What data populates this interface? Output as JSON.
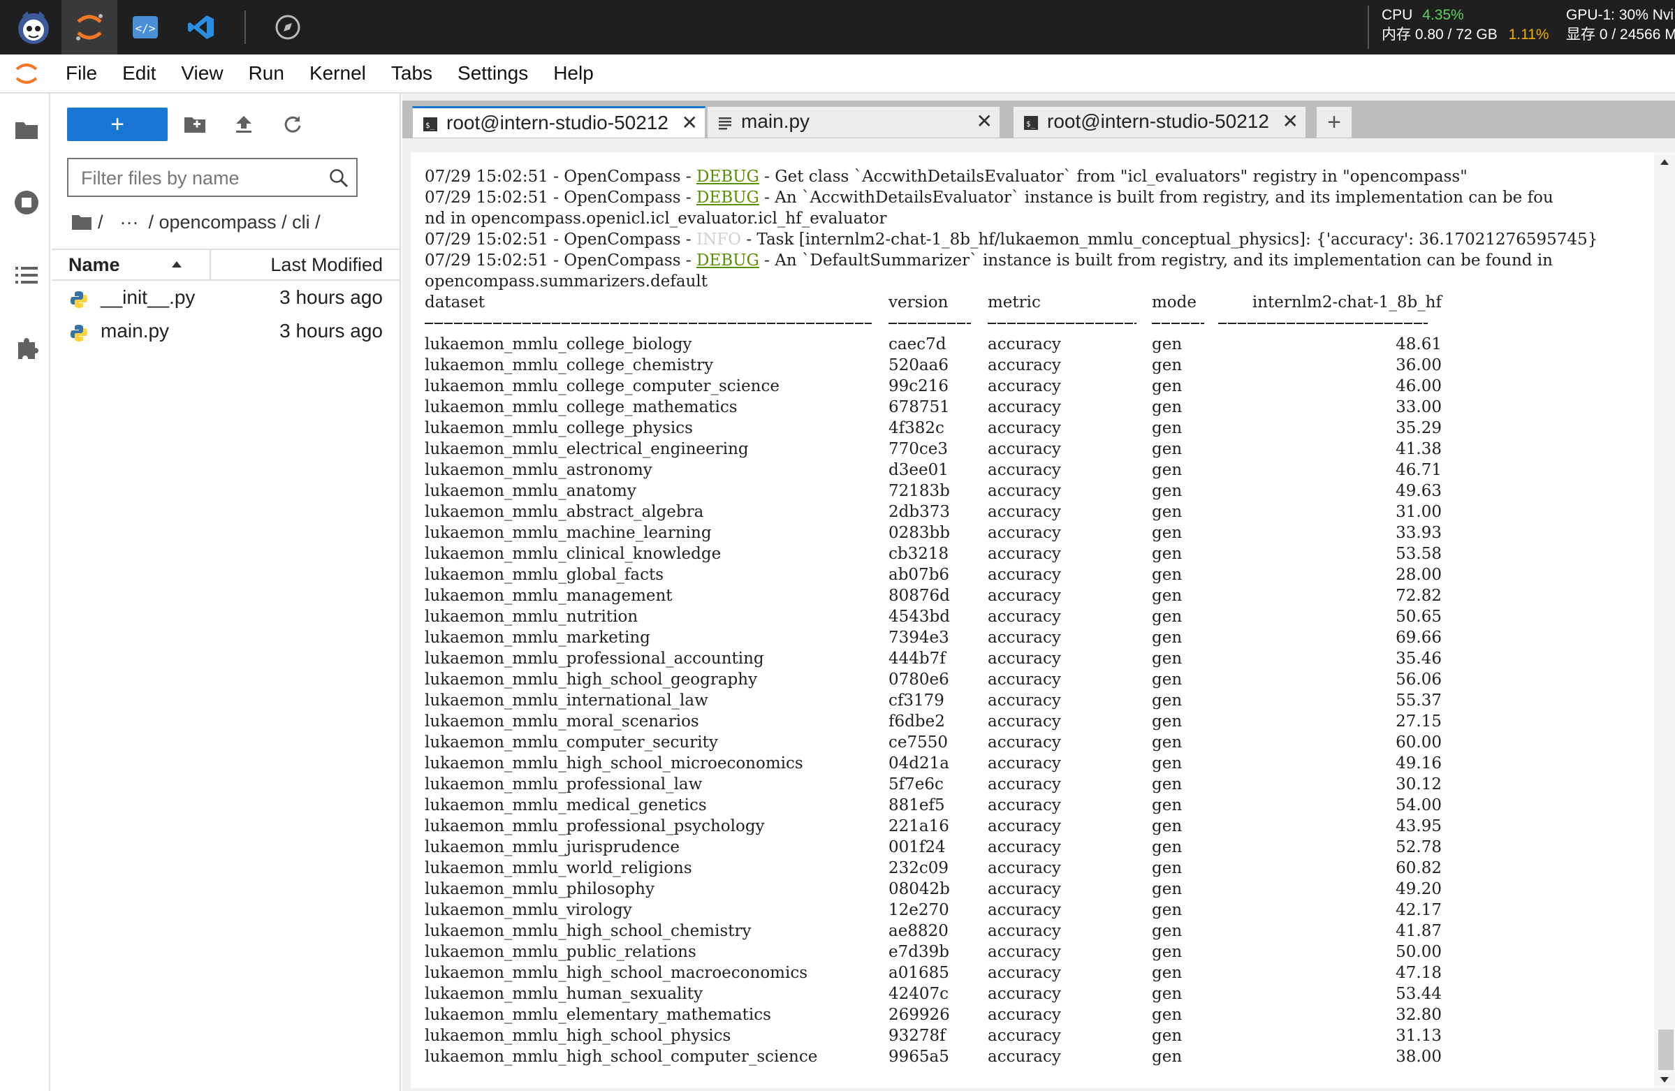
{
  "sysmon": {
    "cpu_label": "CPU",
    "cpu_value": "4.35%",
    "gpu_label": "GPU-1: 30% Nvi",
    "mem_label": "内存 0.80 / 72 GB",
    "mem_pct": "1.11%",
    "vram_label": "显存 0 / 24566 M"
  },
  "menu": [
    "File",
    "Edit",
    "View",
    "Run",
    "Kernel",
    "Tabs",
    "Settings",
    "Help"
  ],
  "filebrowser": {
    "new_label": "+",
    "filter_placeholder": "Filter files by name",
    "crumbs": [
      "/",
      "···",
      "/ opencompass / cli /"
    ],
    "col_name": "Name",
    "col_modified": "Last Modified",
    "files": [
      {
        "name": "__init__.py",
        "modified": "3 hours ago"
      },
      {
        "name": "main.py",
        "modified": "3 hours ago"
      }
    ]
  },
  "tabs": [
    {
      "title": "root@intern-studio-50212",
      "icon": "terminal-icon"
    },
    {
      "title": "main.py",
      "icon": "text-file-icon"
    },
    {
      "title": "root@intern-studio-50212",
      "icon": "terminal-icon"
    }
  ],
  "terminal": {
    "log": [
      {
        "pre": "07/29 15:02:51 - OpenCompass - ",
        "level": "DEBUG",
        "post": " - Get class `AccwithDetailsEvaluator` from \"icl_evaluators\" registry in \"opencompass\""
      },
      {
        "pre": "07/29 15:02:51 - OpenCompass - ",
        "level": "DEBUG",
        "post": " - An `AccwithDetailsEvaluator` instance is built from registry, and its implementation can be fou"
      },
      {
        "pre": "nd in opencompass.openicl.icl_evaluator.icl_hf_evaluator",
        "level": "",
        "post": ""
      },
      {
        "pre": "07/29 15:02:51 - OpenCompass - ",
        "level": "INFO",
        "post": " - Task [internlm2-chat-1_8b_hf/lukaemon_mmlu_conceptual_physics]: {'accuracy': 36.17021276595745}"
      },
      {
        "pre": "07/29 15:02:51 - OpenCompass - ",
        "level": "DEBUG",
        "post": " - An `DefaultSummarizer` instance is built from registry, and its implementation can be found in"
      },
      {
        "pre": "opencompass.summarizers.default",
        "level": "",
        "post": ""
      }
    ],
    "headers": {
      "dataset": "dataset",
      "version": "version",
      "metric": "metric",
      "mode": "mode",
      "model": "internlm2-chat-1_8b_hf"
    },
    "rows": [
      [
        "lukaemon_mmlu_college_biology",
        "caec7d",
        "accuracy",
        "gen",
        "48.61"
      ],
      [
        "lukaemon_mmlu_college_chemistry",
        "520aa6",
        "accuracy",
        "gen",
        "36.00"
      ],
      [
        "lukaemon_mmlu_college_computer_science",
        "99c216",
        "accuracy",
        "gen",
        "46.00"
      ],
      [
        "lukaemon_mmlu_college_mathematics",
        "678751",
        "accuracy",
        "gen",
        "33.00"
      ],
      [
        "lukaemon_mmlu_college_physics",
        "4f382c",
        "accuracy",
        "gen",
        "35.29"
      ],
      [
        "lukaemon_mmlu_electrical_engineering",
        "770ce3",
        "accuracy",
        "gen",
        "41.38"
      ],
      [
        "lukaemon_mmlu_astronomy",
        "d3ee01",
        "accuracy",
        "gen",
        "46.71"
      ],
      [
        "lukaemon_mmlu_anatomy",
        "72183b",
        "accuracy",
        "gen",
        "49.63"
      ],
      [
        "lukaemon_mmlu_abstract_algebra",
        "2db373",
        "accuracy",
        "gen",
        "31.00"
      ],
      [
        "lukaemon_mmlu_machine_learning",
        "0283bb",
        "accuracy",
        "gen",
        "33.93"
      ],
      [
        "lukaemon_mmlu_clinical_knowledge",
        "cb3218",
        "accuracy",
        "gen",
        "53.58"
      ],
      [
        "lukaemon_mmlu_global_facts",
        "ab07b6",
        "accuracy",
        "gen",
        "28.00"
      ],
      [
        "lukaemon_mmlu_management",
        "80876d",
        "accuracy",
        "gen",
        "72.82"
      ],
      [
        "lukaemon_mmlu_nutrition",
        "4543bd",
        "accuracy",
        "gen",
        "50.65"
      ],
      [
        "lukaemon_mmlu_marketing",
        "7394e3",
        "accuracy",
        "gen",
        "69.66"
      ],
      [
        "lukaemon_mmlu_professional_accounting",
        "444b7f",
        "accuracy",
        "gen",
        "35.46"
      ],
      [
        "lukaemon_mmlu_high_school_geography",
        "0780e6",
        "accuracy",
        "gen",
        "56.06"
      ],
      [
        "lukaemon_mmlu_international_law",
        "cf3179",
        "accuracy",
        "gen",
        "55.37"
      ],
      [
        "lukaemon_mmlu_moral_scenarios",
        "f6dbe2",
        "accuracy",
        "gen",
        "27.15"
      ],
      [
        "lukaemon_mmlu_computer_security",
        "ce7550",
        "accuracy",
        "gen",
        "60.00"
      ],
      [
        "lukaemon_mmlu_high_school_microeconomics",
        "04d21a",
        "accuracy",
        "gen",
        "49.16"
      ],
      [
        "lukaemon_mmlu_professional_law",
        "5f7e6c",
        "accuracy",
        "gen",
        "30.12"
      ],
      [
        "lukaemon_mmlu_medical_genetics",
        "881ef5",
        "accuracy",
        "gen",
        "54.00"
      ],
      [
        "lukaemon_mmlu_professional_psychology",
        "221a16",
        "accuracy",
        "gen",
        "43.95"
      ],
      [
        "lukaemon_mmlu_jurisprudence",
        "001f24",
        "accuracy",
        "gen",
        "52.78"
      ],
      [
        "lukaemon_mmlu_world_religions",
        "232c09",
        "accuracy",
        "gen",
        "60.82"
      ],
      [
        "lukaemon_mmlu_philosophy",
        "08042b",
        "accuracy",
        "gen",
        "49.20"
      ],
      [
        "lukaemon_mmlu_virology",
        "12e270",
        "accuracy",
        "gen",
        "42.17"
      ],
      [
        "lukaemon_mmlu_high_school_chemistry",
        "ae8820",
        "accuracy",
        "gen",
        "41.87"
      ],
      [
        "lukaemon_mmlu_public_relations",
        "e7d39b",
        "accuracy",
        "gen",
        "50.00"
      ],
      [
        "lukaemon_mmlu_high_school_macroeconomics",
        "a01685",
        "accuracy",
        "gen",
        "47.18"
      ],
      [
        "lukaemon_mmlu_human_sexuality",
        "42407c",
        "accuracy",
        "gen",
        "53.44"
      ],
      [
        "lukaemon_mmlu_elementary_mathematics",
        "269926",
        "accuracy",
        "gen",
        "32.80"
      ],
      [
        "lukaemon_mmlu_high_school_physics",
        "93278f",
        "accuracy",
        "gen",
        "31.13"
      ],
      [
        "lukaemon_mmlu_high_school_computer_science",
        "9965a5",
        "accuracy",
        "gen",
        "38.00"
      ]
    ]
  },
  "colors": {
    "accent": "#1976d2",
    "debug": "#5a8f00",
    "info": "#d0d0d0",
    "cpu": "#5fd35f",
    "mem_pct": "#f0b000"
  }
}
